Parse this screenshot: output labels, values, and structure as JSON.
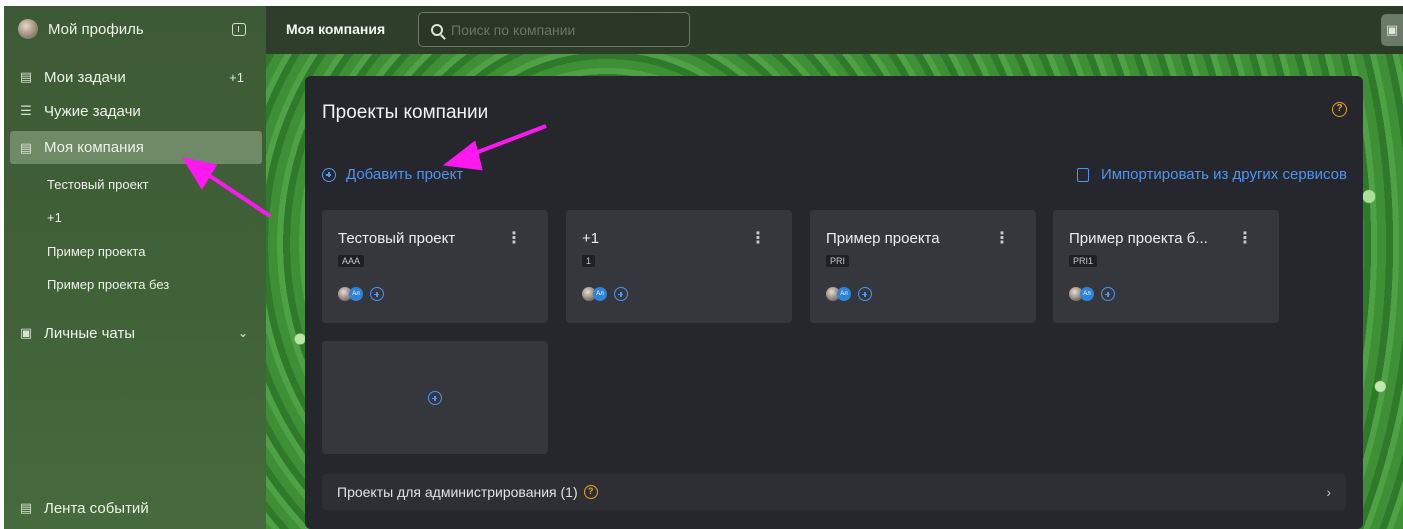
{
  "sidebar": {
    "profile_label": "Мой профиль",
    "items": [
      {
        "label": "Мои задачи",
        "badge": "+1"
      },
      {
        "label": "Чужие задачи"
      },
      {
        "label": "Моя компания"
      },
      {
        "label": "Личные чаты"
      }
    ],
    "subitems": [
      "Тестовый проект",
      "+1",
      "Пример проекта",
      "Пример проекта без"
    ],
    "footer_label": "Лента событий"
  },
  "topbar": {
    "title": "Моя компания",
    "search_placeholder": "Поиск по компании"
  },
  "panel": {
    "title": "Проекты компании",
    "add_project": "Добавить проект",
    "import_label": "Импортировать из других сервисов",
    "help_glyph": "?",
    "admin_row": "Проекты для администрирования (1)",
    "cards": [
      {
        "name": "Тестовый проект",
        "code": "AAA"
      },
      {
        "name": "+1",
        "code": "1"
      },
      {
        "name": "Пример проекта",
        "code": "PRI"
      },
      {
        "name": "Пример проекта б...",
        "code": "PRI1"
      }
    ],
    "avatar_initials": "Ал"
  },
  "colors": {
    "accent": "#4d95f2",
    "help": "#f0a31b",
    "annotation_arrow": "#ff19f0"
  }
}
